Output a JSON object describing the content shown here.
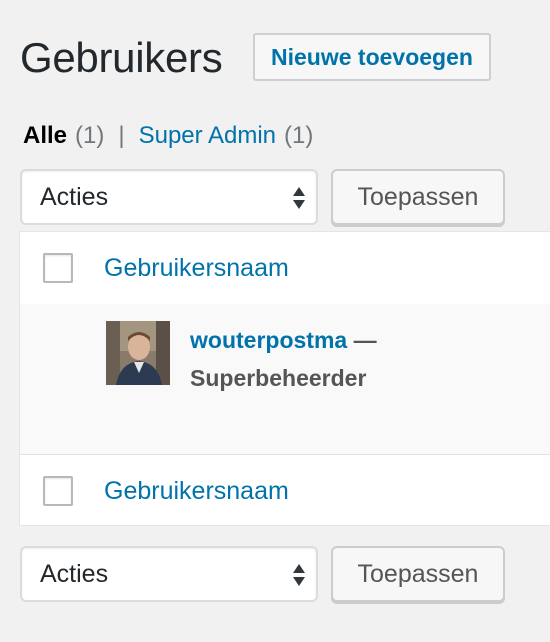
{
  "header": {
    "title": "Gebruikers",
    "add_new_label": "Nieuwe toevoegen"
  },
  "filters": {
    "all_label": "Alle",
    "all_count": "(1)",
    "separator": "|",
    "super_admin_label": "Super Admin",
    "super_admin_count": "(1)"
  },
  "bulk_actions": {
    "select_value": "Acties",
    "apply_label": "Toepassen"
  },
  "table": {
    "column_username": "Gebruikersnaam",
    "rows": [
      {
        "username": "wouterpostma",
        "dash": "—",
        "role": "Superbeheerder"
      }
    ]
  },
  "colors": {
    "link": "#0073aa",
    "background": "#f1f1f1",
    "text": "#23282d"
  }
}
